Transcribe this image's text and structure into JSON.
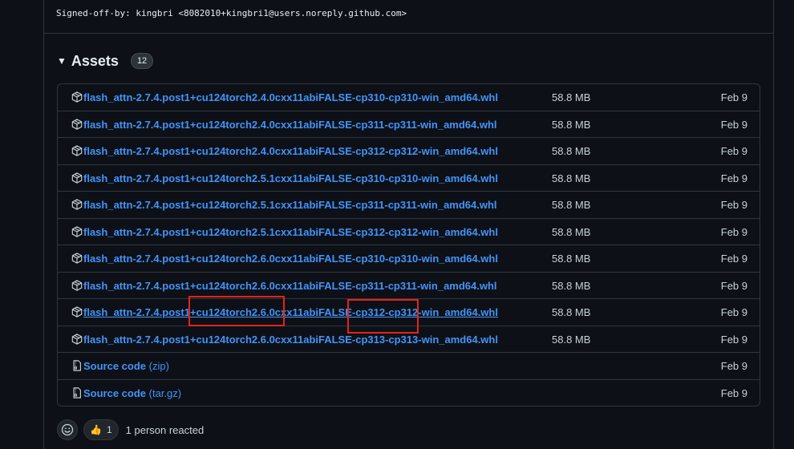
{
  "commit": {
    "signoff": "Signed-off-by: kingbri <8082010+kingbri1@users.noreply.github.com>"
  },
  "assets": {
    "title": "Assets",
    "count": "12",
    "items": [
      {
        "name": "flash_attn-2.7.4.post1+cu124torch2.4.0cxx11abiFALSE-cp310-cp310-win_amd64.whl",
        "size": "58.8 MB",
        "date": "Feb 9"
      },
      {
        "name": "flash_attn-2.7.4.post1+cu124torch2.4.0cxx11abiFALSE-cp311-cp311-win_amd64.whl",
        "size": "58.8 MB",
        "date": "Feb 9"
      },
      {
        "name": "flash_attn-2.7.4.post1+cu124torch2.4.0cxx11abiFALSE-cp312-cp312-win_amd64.whl",
        "size": "58.8 MB",
        "date": "Feb 9"
      },
      {
        "name": "flash_attn-2.7.4.post1+cu124torch2.5.1cxx11abiFALSE-cp310-cp310-win_amd64.whl",
        "size": "58.8 MB",
        "date": "Feb 9"
      },
      {
        "name": "flash_attn-2.7.4.post1+cu124torch2.5.1cxx11abiFALSE-cp311-cp311-win_amd64.whl",
        "size": "58.8 MB",
        "date": "Feb 9"
      },
      {
        "name": "flash_attn-2.7.4.post1+cu124torch2.5.1cxx11abiFALSE-cp312-cp312-win_amd64.whl",
        "size": "58.8 MB",
        "date": "Feb 9"
      },
      {
        "name": "flash_attn-2.7.4.post1+cu124torch2.6.0cxx11abiFALSE-cp310-cp310-win_amd64.whl",
        "size": "58.8 MB",
        "date": "Feb 9"
      },
      {
        "name": "flash_attn-2.7.4.post1+cu124torch2.6.0cxx11abiFALSE-cp311-cp311-win_amd64.whl",
        "size": "58.8 MB",
        "date": "Feb 9"
      },
      {
        "name": "flash_attn-2.7.4.post1+cu124torch2.6.0cxx11abiFALSE-cp312-cp312-win_amd64.whl",
        "size": "58.8 MB",
        "date": "Feb 9"
      },
      {
        "name": "flash_attn-2.7.4.post1+cu124torch2.6.0cxx11abiFALSE-cp313-cp313-win_amd64.whl",
        "size": "58.8 MB",
        "date": "Feb 9"
      }
    ],
    "source_zip": {
      "label": "Source code",
      "suffix": "(zip)",
      "date": "Feb 9"
    },
    "source_tar": {
      "label": "Source code",
      "suffix": "(tar.gz)",
      "date": "Feb 9"
    }
  },
  "reactions": {
    "emoji": "👍",
    "count": "1",
    "summary": "1 person reacted"
  },
  "colors": {
    "background": "#0d1117",
    "border": "#30363d",
    "link": "#4493f8",
    "annotation_red": "#e5231b"
  },
  "icons": {
    "asset": "package-icon",
    "source": "file-zip-icon",
    "picker": "smiley-icon"
  }
}
